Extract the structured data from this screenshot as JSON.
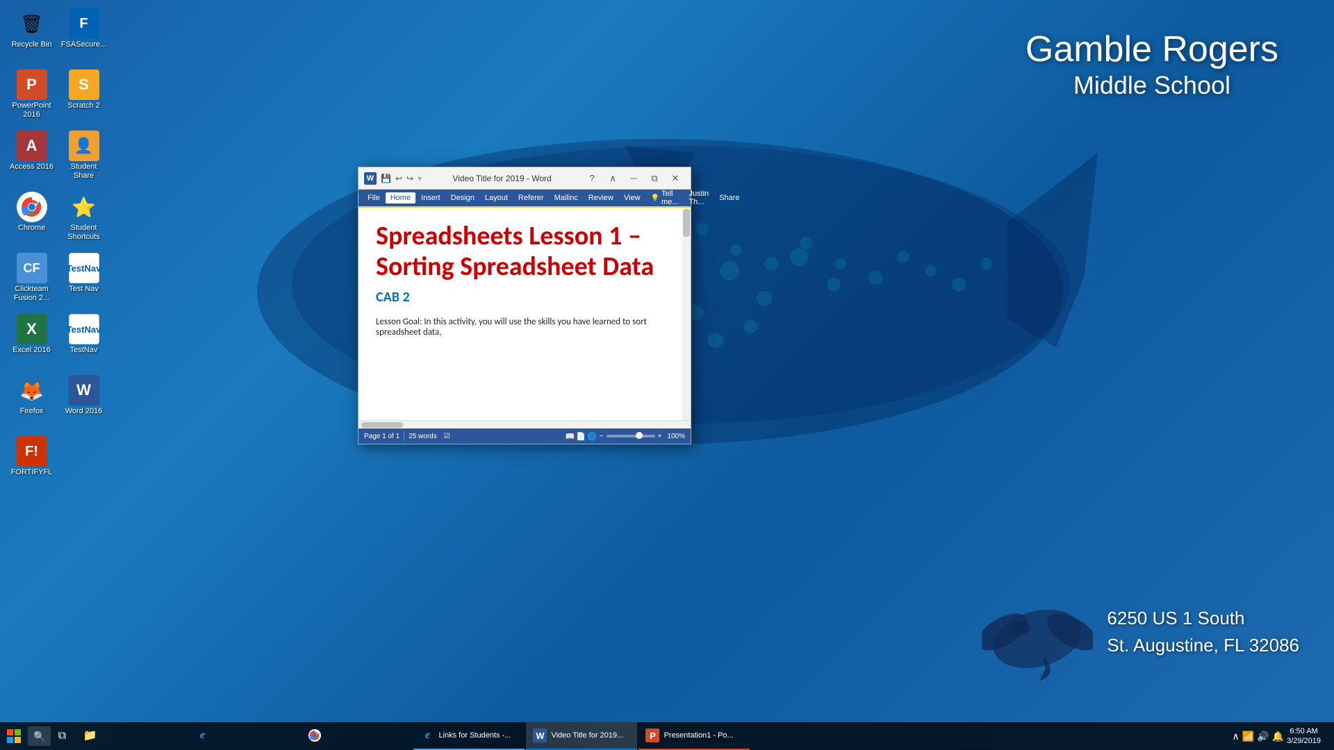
{
  "desktop": {
    "background_color": "#1a6aad"
  },
  "school": {
    "name_line1": "Gamble Rogers",
    "name_line2": "Middle School",
    "address_line1": "6250 US 1 South",
    "address_line2": "St. Augustine, FL 32086"
  },
  "desktop_icons": [
    {
      "id": "recycle-bin",
      "label": "Recycle Bin",
      "icon": "🗑",
      "color": "transparent"
    },
    {
      "id": "powerpoint-2016",
      "label": "PowerPoint 2016",
      "icon": "P",
      "color": "#d04b26"
    },
    {
      "id": "access-2016",
      "label": "Access 2016",
      "icon": "A",
      "color": "#a4373a"
    },
    {
      "id": "scratch-2",
      "label": "Scratch 2",
      "icon": "S",
      "color": "#f5a623"
    },
    {
      "id": "chrome",
      "label": "Chrome",
      "icon": "⬤",
      "color": "#4285f4"
    },
    {
      "id": "student-share",
      "label": "Student Share",
      "icon": "👤",
      "color": "#f0a030"
    },
    {
      "id": "clickteam",
      "label": "Clickteam Fusion 2...",
      "icon": "C",
      "color": "#4a90d9"
    },
    {
      "id": "student-shortcuts",
      "label": "Student Shortcuts",
      "icon": "⭐",
      "color": "#f5a623"
    },
    {
      "id": "excel-2016",
      "label": "Excel 2016",
      "icon": "X",
      "color": "#217346"
    },
    {
      "id": "testnav-pearson",
      "label": "Test Nav",
      "icon": "T",
      "color": "#005faf"
    },
    {
      "id": "firefox",
      "label": "Firefox",
      "icon": "🦊",
      "color": "transparent"
    },
    {
      "id": "testnav2",
      "label": "TestNav",
      "icon": "T",
      "color": "#005faf"
    },
    {
      "id": "fortifyfl",
      "label": "FORTIFYFL",
      "icon": "F",
      "color": "#cc3300"
    },
    {
      "id": "word-2016",
      "label": "Word 2016",
      "icon": "W",
      "color": "#2b579a"
    },
    {
      "id": "fsasecure",
      "label": "FSASecure...",
      "icon": "F",
      "color": "#0062b2"
    }
  ],
  "word_window": {
    "title": "Video Title for 2019 - Word",
    "doc_title": "Spreadsheets Lesson 1 – Sorting Spreadsheet Data",
    "cab": "CAB 2",
    "lesson_goal": "Lesson Goal:  In this activity, you will use the skills you have learned to sort spreadsheet data,",
    "menu_items": [
      "File",
      "Home",
      "Insert",
      "Design",
      "Layout",
      "Referer",
      "Mailinc",
      "Review",
      "View",
      "Tell me...",
      "Justin Th...",
      "Share"
    ],
    "statusbar": {
      "page": "Page 1 of 1",
      "words": "25 words",
      "zoom": "100%"
    }
  },
  "taskbar": {
    "time": "6:50 AM",
    "date": "3/29/2019",
    "apps": [
      {
        "id": "file-explorer",
        "label": "",
        "icon": "📁",
        "active": false
      },
      {
        "id": "ie-browser",
        "label": "",
        "icon": "e",
        "active": false
      },
      {
        "id": "chrome-task",
        "label": "",
        "icon": "⬤",
        "active": false
      },
      {
        "id": "links-students",
        "label": "Links for Students -...",
        "icon": "e",
        "active": false
      },
      {
        "id": "word-task",
        "label": "Video Title for 2019...",
        "icon": "W",
        "active": true
      },
      {
        "id": "powerpoint-task",
        "label": "Presentation1 - Po...",
        "icon": "P",
        "active": false
      }
    ]
  }
}
